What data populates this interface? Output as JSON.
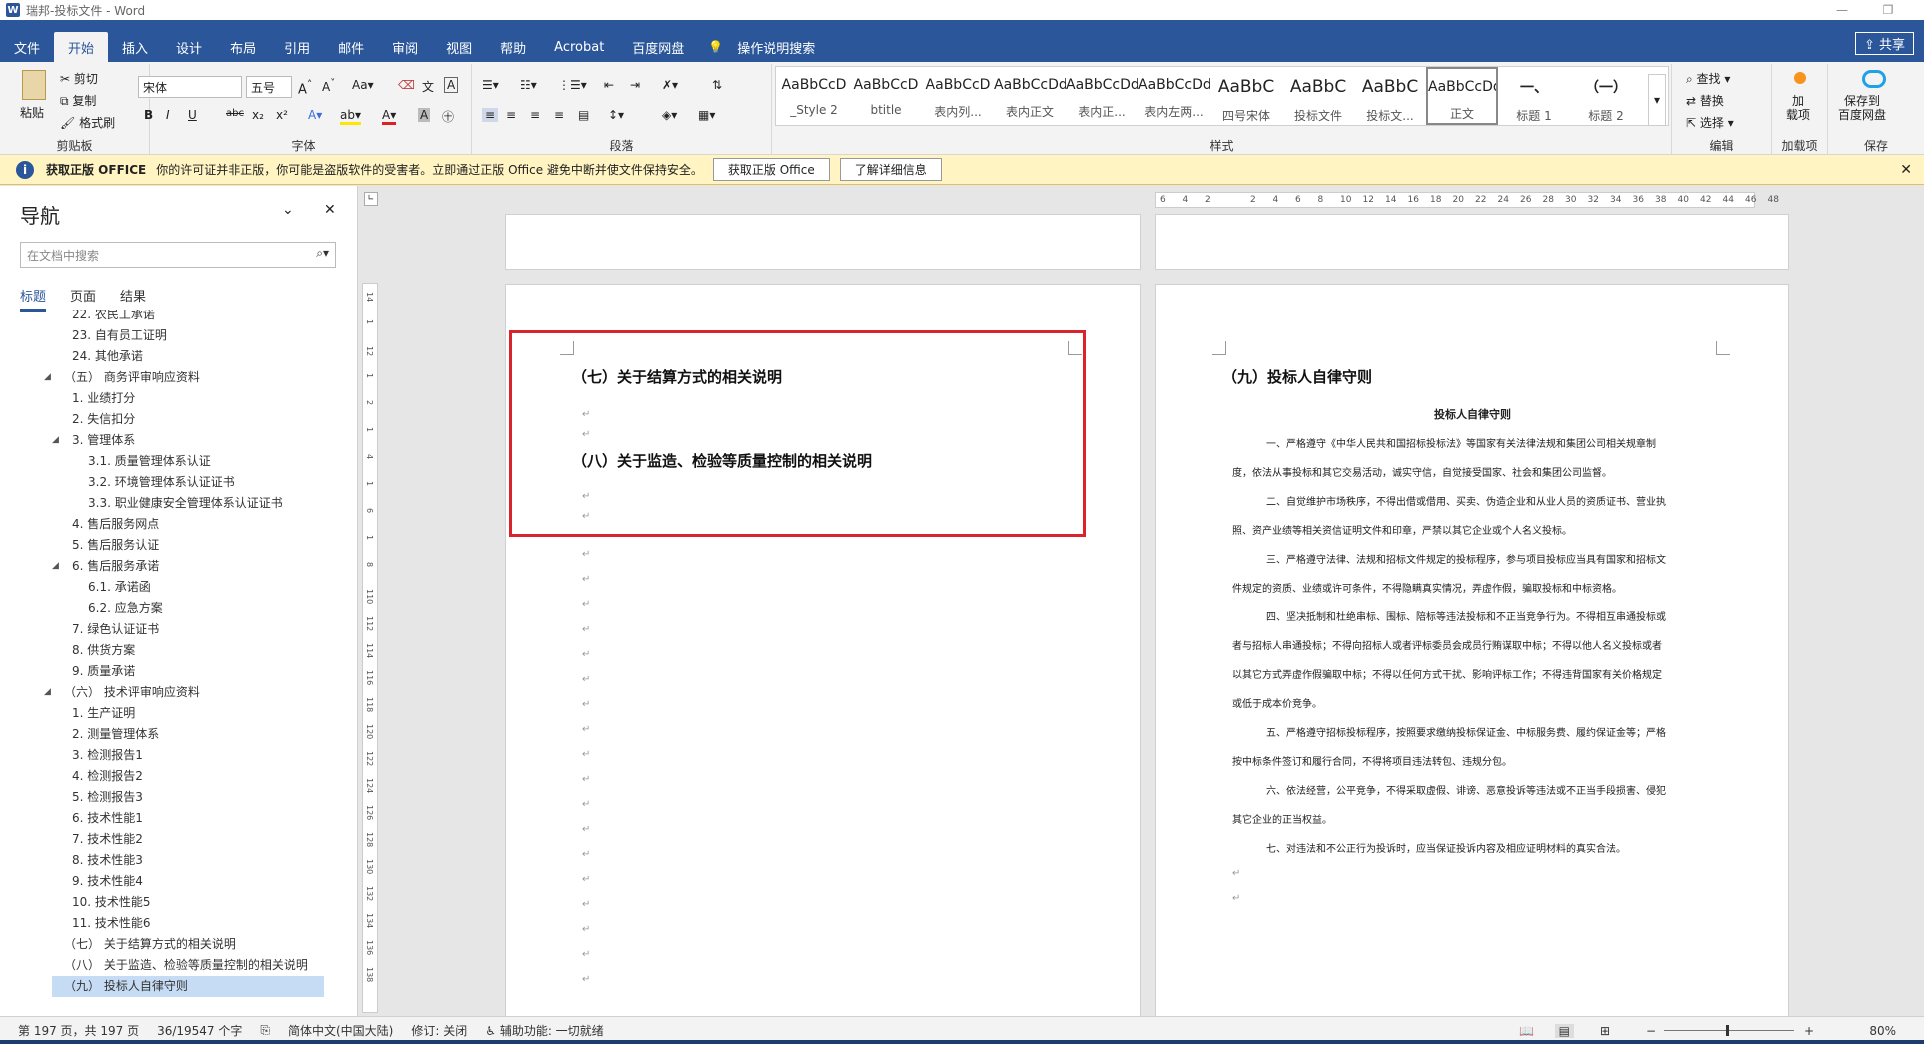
{
  "window": {
    "title": "瑞邦-投标文件 - Word",
    "app_icon": "W",
    "min": "—",
    "restore": "❐"
  },
  "menu": {
    "items": [
      "文件",
      "开始",
      "插入",
      "设计",
      "布局",
      "引用",
      "邮件",
      "审阅",
      "视图",
      "帮助",
      "Acrobat",
      "百度网盘",
      "操作说明搜索"
    ],
    "active": "开始",
    "share": "共享"
  },
  "ribbon": {
    "clipboard": {
      "paste": "粘贴",
      "cut": "剪切",
      "copy": "复制",
      "format_painter": "格式刷",
      "label": "剪贴板"
    },
    "font": {
      "font_name": "宋体",
      "font_size": "五号",
      "bold": "B",
      "italic": "I",
      "underline": "U",
      "strike": "abc",
      "sub": "x₂",
      "sup": "x²",
      "label": "字体"
    },
    "paragraph": {
      "label": "段落"
    },
    "styles": {
      "label": "样式",
      "items": [
        {
          "preview": "AaBbCcD",
          "name": "_Style 2"
        },
        {
          "preview": "AaBbCcD",
          "name": "btitle"
        },
        {
          "preview": "AaBbCcD",
          "name": "表内列..."
        },
        {
          "preview": "AaBbCcDdI",
          "name": "表内正文"
        },
        {
          "preview": "AaBbCcDdI",
          "name": "表内正..."
        },
        {
          "preview": "AaBbCcDdEe",
          "name": "表内左两..."
        },
        {
          "preview": "AaBbC",
          "name": "四号宋体"
        },
        {
          "preview": "AaBbC",
          "name": "投标文件"
        },
        {
          "preview": "AaBbC",
          "name": "投标文..."
        },
        {
          "preview": "AaBbCcDdI",
          "name": "正文"
        },
        {
          "preview": "一、",
          "name": "标题 1"
        },
        {
          "preview": "（一）",
          "name": "标题 2"
        }
      ]
    },
    "editing": {
      "find": "查找",
      "replace": "替换",
      "select": "选择",
      "label": "编辑"
    },
    "addins": {
      "text": "加\n载项",
      "label": "加载项"
    },
    "save": {
      "text": "保存到\n百度网盘",
      "label": "保存"
    }
  },
  "infobar": {
    "bold": "获取正版 OFFICE",
    "message": "你的许可证并非正版，你可能是盗版软件的受害者。立即通过正版 Office 避免中断并使文件保持安全。",
    "btn1": "获取正版 Office",
    "btn2": "了解详细信息"
  },
  "nav": {
    "title": "导航",
    "search_placeholder": "在文档中搜索",
    "tabs": [
      "标题",
      "页面",
      "结果"
    ],
    "items": [
      {
        "text": "22. 农民工承诺",
        "indent": 3
      },
      {
        "text": "23. 自有员工证明",
        "indent": 3
      },
      {
        "text": "24. 其他承诺",
        "indent": 3
      },
      {
        "text": "（五） 商务评审响应资料",
        "indent": 2,
        "tri": true
      },
      {
        "text": "1. 业绩打分",
        "indent": 3
      },
      {
        "text": "2. 失信扣分",
        "indent": 3
      },
      {
        "text": "3. 管理体系",
        "indent": 3,
        "tri": true
      },
      {
        "text": "3.1. 质量管理体系认证",
        "indent": 4
      },
      {
        "text": "3.2. 环境管理体系认证证书",
        "indent": 4
      },
      {
        "text": "3.3. 职业健康安全管理体系认证证书",
        "indent": 4
      },
      {
        "text": "4. 售后服务网点",
        "indent": 3
      },
      {
        "text": "5. 售后服务认证",
        "indent": 3
      },
      {
        "text": "6. 售后服务承诺",
        "indent": 3,
        "tri": true
      },
      {
        "text": "6.1. 承诺函",
        "indent": 4
      },
      {
        "text": "6.2. 应急方案",
        "indent": 4
      },
      {
        "text": "7. 绿色认证证书",
        "indent": 3
      },
      {
        "text": "8. 供货方案",
        "indent": 3
      },
      {
        "text": "9. 质量承诺",
        "indent": 3
      },
      {
        "text": "（六） 技术评审响应资料",
        "indent": 2,
        "tri": true
      },
      {
        "text": "1. 生产证明",
        "indent": 3
      },
      {
        "text": "2. 测量管理体系",
        "indent": 3
      },
      {
        "text": "3. 检测报告1",
        "indent": 3
      },
      {
        "text": "4. 检测报告2",
        "indent": 3
      },
      {
        "text": "5. 检测报告3",
        "indent": 3
      },
      {
        "text": "6. 技术性能1",
        "indent": 3
      },
      {
        "text": "7. 技术性能2",
        "indent": 3
      },
      {
        "text": "8. 技术性能3",
        "indent": 3
      },
      {
        "text": "9. 技术性能4",
        "indent": 3
      },
      {
        "text": "10. 技术性能5",
        "indent": 3
      },
      {
        "text": "11. 技术性能6",
        "indent": 3
      },
      {
        "text": "（七） 关于结算方式的相关说明",
        "indent": 2
      },
      {
        "text": "（八） 关于监造、检验等质量控制的相关说明",
        "indent": 2
      },
      {
        "text": "（九） 投标人自律守则",
        "indent": 2,
        "active": true
      }
    ]
  },
  "doc": {
    "left_headings": [
      "（七）关于结算方式的相关说明",
      "（八）关于监造、检验等质量控制的相关说明"
    ],
    "right_heading": "（九）投标人自律守则",
    "right_subtitle": "投标人自律守则",
    "right_lines": [
      "一、严格遵守《中华人民共和国招标投标法》等国家有关法律法规和集团公司相关规章制",
      "度，依法从事投标和其它交易活动，诚实守信，自觉接受国家、社会和集团公司监督。",
      "二、自觉维护市场秩序，不得出借或借用、买卖、伪造企业和从业人员的资质证书、营业执",
      "照、资产业绩等相关资信证明文件和印章，严禁以其它企业或个人名义投标。",
      "三、严格遵守法律、法规和招标文件规定的投标程序，参与项目投标应当具有国家和招标文",
      "件规定的资质、业绩或许可条件，不得隐瞒真实情况，弄虚作假，骗取投标和中标资格。",
      "四、坚决抵制和杜绝串标、围标、陪标等违法投标和不正当竞争行为。不得相互串通投标或",
      "者与招标人串通投标；不得向招标人或者评标委员会成员行贿谋取中标；不得以他人名义投标或者",
      "以其它方式弄虚作假骗取中标；不得以任何方式干扰、影响评标工作；不得违背国家有关价格规定",
      "或低于成本价竞争。",
      "五、严格遵守招标投标程序，按照要求缴纳投标保证金、中标服务费、履约保证金等；严格",
      "按中标条件签订和履行合同，不得将项目违法转包、违规分包。",
      "六、依法经营，公平竞争，不得采取虚假、诽谤、恶意投诉等违法或不正当手段损害、侵犯",
      "其它企业的正当权益。",
      "七、对违法和不公正行为投诉时，应当保证投诉内容及相应证明材料的真实合法。"
    ],
    "para_mark": "↵",
    "ruler_h": [
      "6",
      "4",
      "2",
      "",
      "2",
      "4",
      "6",
      "8",
      "10",
      "12",
      "14",
      "16",
      "18",
      "20",
      "22",
      "24",
      "26",
      "28",
      "30",
      "32",
      "34",
      "36",
      "38",
      "40",
      "42",
      "44",
      "46",
      "48"
    ],
    "ruler_v": [
      "14",
      "1",
      "12",
      "1",
      "2",
      "1",
      "4",
      "1",
      "6",
      "1",
      "8",
      "110",
      "112",
      "114",
      "116",
      "118",
      "120",
      "122",
      "124",
      "126",
      "128",
      "130",
      "132",
      "134",
      "136",
      "138"
    ]
  },
  "status": {
    "page": "第 197 页，共 197 页",
    "words": "36/19547 个字",
    "lang": "简体中文(中国大陆)",
    "revisions": "修订: 关闭",
    "access": "辅助功能: 一切就绪",
    "zoom": "80%"
  }
}
